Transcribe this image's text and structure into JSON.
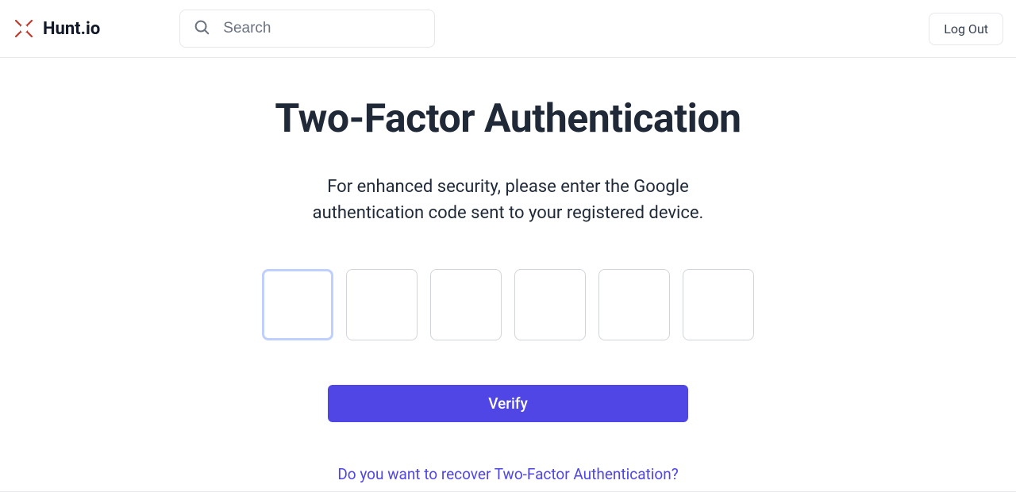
{
  "header": {
    "brand": "Hunt.io",
    "search_placeholder": "Search",
    "logout_label": "Log Out"
  },
  "main": {
    "title": "Two-Factor Authentication",
    "subtitle": "For enhanced security, please enter the Google authentication code sent to your registered device.",
    "code_fields": [
      "",
      "",
      "",
      "",
      "",
      ""
    ],
    "focused_index": 0,
    "verify_label": "Verify",
    "recover_label": "Do you want to recover Two-Factor Authentication?"
  },
  "colors": {
    "accent": "#4f46e5",
    "focus_ring": "#bfcfff",
    "border": "#e5e7eb",
    "text": "#1f2937",
    "brand_red": "#c0392b"
  }
}
